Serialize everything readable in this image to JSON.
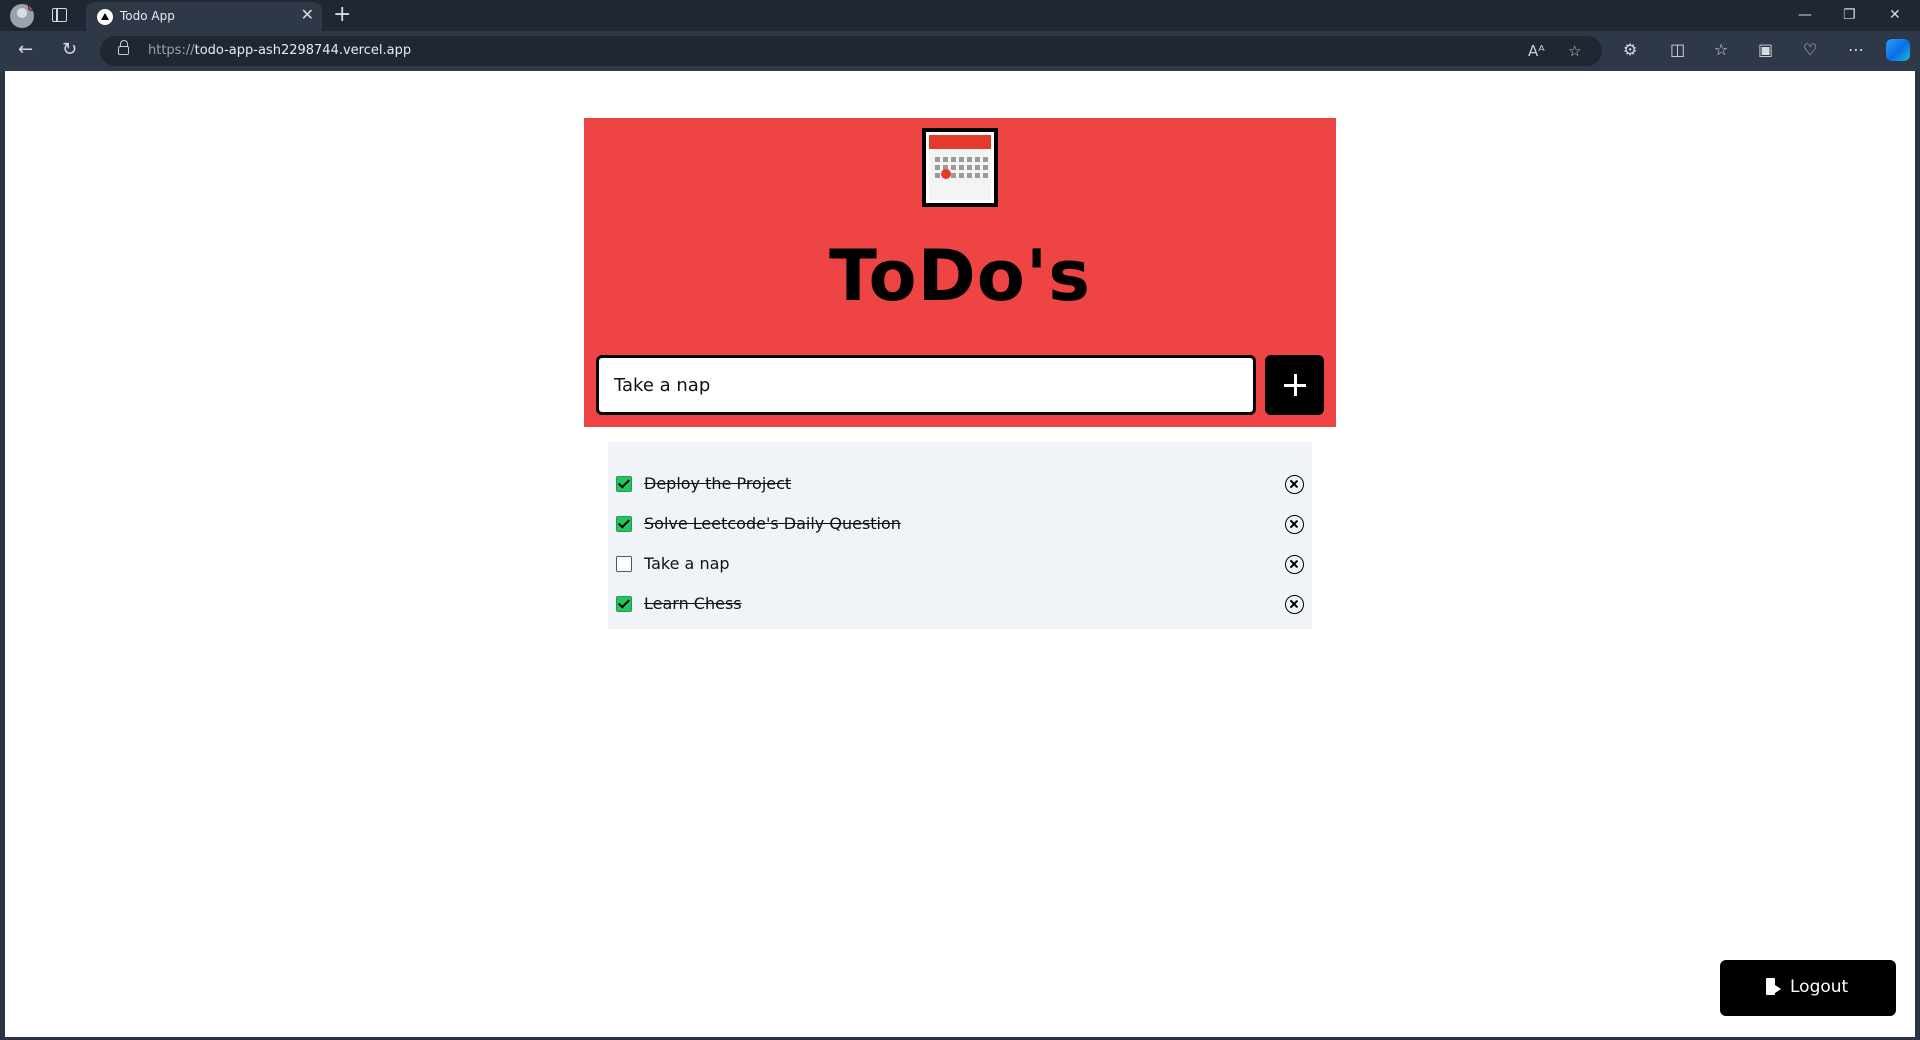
{
  "browser": {
    "tab_title": "Todo App",
    "tab_close": "✕",
    "new_tab": "+",
    "url_scheme": "https://",
    "url_host": "todo-app-ash2298744.vercel.app",
    "window_minimize": "—",
    "window_restore": "❐",
    "window_close": "✕",
    "back": "←",
    "refresh": "↻",
    "read_aloud": "Aᴬ",
    "favorite": "☆",
    "extensions": "⚙",
    "split_screen": "◫",
    "favorites_bar": "☆",
    "collections": "▣",
    "browser_essentials": "♡",
    "more": "⋯"
  },
  "app": {
    "title": "ToDo's",
    "input_value": "Take a nap",
    "todos": [
      {
        "text": "Deploy the Project",
        "done": true
      },
      {
        "text": "Solve Leetcode's Daily Question",
        "done": true
      },
      {
        "text": "Take a nap",
        "done": false
      },
      {
        "text": "Learn Chess",
        "done": true
      }
    ],
    "logout_label": "Logout"
  },
  "colors": {
    "hero_bg": "#ef4444",
    "list_bg": "#f0f4f8",
    "checkbox_checked": "#22c55e",
    "button_bg": "#000000"
  }
}
